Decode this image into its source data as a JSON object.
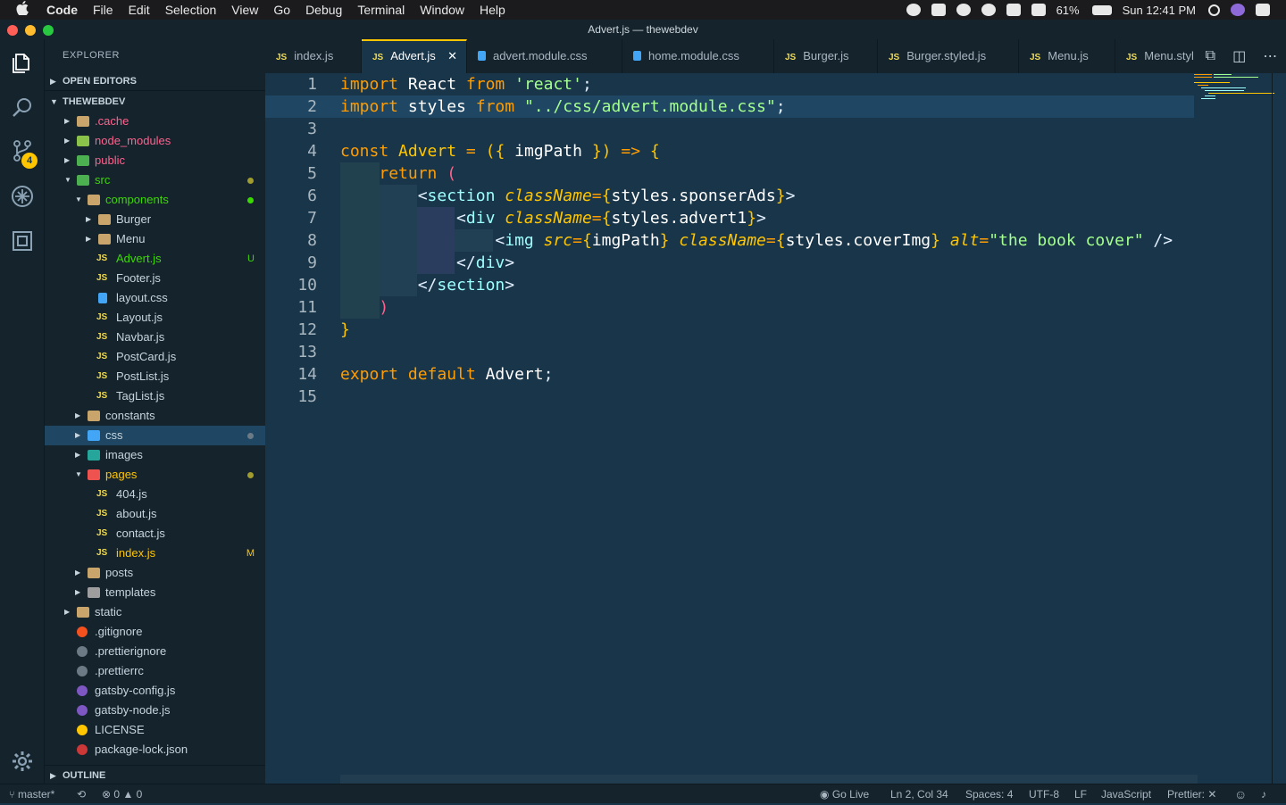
{
  "menubar": {
    "app": "Code",
    "items": [
      "File",
      "Edit",
      "Selection",
      "View",
      "Go",
      "Debug",
      "Terminal",
      "Window",
      "Help"
    ],
    "battery": "61%",
    "clock": "Sun 12:41 PM"
  },
  "window": {
    "title": "Advert.js — thewebdev"
  },
  "sidebar": {
    "header": "EXPLORER",
    "open_editors": "OPEN EDITORS",
    "project": "THEWEBDEV",
    "outline": "OUTLINE",
    "tree": [
      {
        "label": ".cache",
        "depth": 0,
        "kind": "folder",
        "arrow": "right",
        "color": "#ff628c"
      },
      {
        "label": "node_modules",
        "depth": 0,
        "kind": "folder-node",
        "arrow": "right",
        "color": "#ff628c"
      },
      {
        "label": "public",
        "depth": 0,
        "kind": "folder-public",
        "arrow": "right",
        "color": "#ff628c"
      },
      {
        "label": "src",
        "depth": 0,
        "kind": "folder-src",
        "arrow": "down",
        "color": "#3ad900",
        "dot": "#a09c2d"
      },
      {
        "label": "components",
        "depth": 1,
        "kind": "folder-comp",
        "arrow": "down",
        "color": "#3ad900",
        "dot": "#3ad900"
      },
      {
        "label": "Burger",
        "depth": 2,
        "kind": "folder",
        "arrow": "right",
        "color": "#c6d4de"
      },
      {
        "label": "Menu",
        "depth": 2,
        "kind": "folder",
        "arrow": "right",
        "color": "#c6d4de"
      },
      {
        "label": "Advert.js",
        "depth": 2,
        "kind": "js",
        "color": "#3ad900",
        "status": "U",
        "status_color": "#3ad900"
      },
      {
        "label": "Footer.js",
        "depth": 2,
        "kind": "js",
        "color": "#c6d4de"
      },
      {
        "label": "layout.css",
        "depth": 2,
        "kind": "css",
        "color": "#c6d4de"
      },
      {
        "label": "Layout.js",
        "depth": 2,
        "kind": "js",
        "color": "#c6d4de"
      },
      {
        "label": "Navbar.js",
        "depth": 2,
        "kind": "js",
        "color": "#c6d4de"
      },
      {
        "label": "PostCard.js",
        "depth": 2,
        "kind": "js",
        "color": "#c6d4de"
      },
      {
        "label": "PostList.js",
        "depth": 2,
        "kind": "js",
        "color": "#c6d4de"
      },
      {
        "label": "TagList.js",
        "depth": 2,
        "kind": "js",
        "color": "#c6d4de"
      },
      {
        "label": "constants",
        "depth": 1,
        "kind": "folder",
        "arrow": "right",
        "color": "#c6d4de"
      },
      {
        "label": "css",
        "depth": 1,
        "kind": "folder-css",
        "arrow": "right",
        "color": "#c6d4de",
        "selected": true,
        "dot": "#6c7a86"
      },
      {
        "label": "images",
        "depth": 1,
        "kind": "folder-img",
        "arrow": "right",
        "color": "#c6d4de"
      },
      {
        "label": "pages",
        "depth": 1,
        "kind": "folder-pages",
        "arrow": "down",
        "color": "#ffc600",
        "dot": "#a09c2d"
      },
      {
        "label": "404.js",
        "depth": 2,
        "kind": "js",
        "color": "#c6d4de"
      },
      {
        "label": "about.js",
        "depth": 2,
        "kind": "js",
        "color": "#c6d4de"
      },
      {
        "label": "contact.js",
        "depth": 2,
        "kind": "js",
        "color": "#c6d4de"
      },
      {
        "label": "index.js",
        "depth": 2,
        "kind": "js",
        "color": "#ffc600",
        "status": "M",
        "status_color": "#ffc600"
      },
      {
        "label": "posts",
        "depth": 1,
        "kind": "folder",
        "arrow": "right",
        "color": "#c6d4de"
      },
      {
        "label": "templates",
        "depth": 1,
        "kind": "folder-tpl",
        "arrow": "right",
        "color": "#c6d4de"
      },
      {
        "label": "static",
        "depth": 0,
        "kind": "folder",
        "arrow": "right",
        "color": "#c6d4de"
      },
      {
        "label": ".gitignore",
        "depth": 0,
        "kind": "git",
        "color": "#c6d4de"
      },
      {
        "label": ".prettierignore",
        "depth": 0,
        "kind": "prettier",
        "color": "#c6d4de"
      },
      {
        "label": ".prettierrc",
        "depth": 0,
        "kind": "prettier",
        "color": "#c6d4de"
      },
      {
        "label": "gatsby-config.js",
        "depth": 0,
        "kind": "gatsby",
        "color": "#c6d4de"
      },
      {
        "label": "gatsby-node.js",
        "depth": 0,
        "kind": "gatsby",
        "color": "#c6d4de"
      },
      {
        "label": "LICENSE",
        "depth": 0,
        "kind": "license",
        "color": "#c6d4de"
      },
      {
        "label": "package-lock.json",
        "depth": 0,
        "kind": "npm",
        "color": "#c6d4de"
      }
    ]
  },
  "activity": {
    "scm_badge": "4"
  },
  "tabs": [
    {
      "label": "index.js",
      "kind": "js",
      "width": 108
    },
    {
      "label": "Advert.js",
      "kind": "js",
      "active": true,
      "width": 118,
      "close": "✕"
    },
    {
      "label": "advert.module.css",
      "kind": "css",
      "width": 174
    },
    {
      "label": "home.module.css",
      "kind": "css",
      "width": 170
    },
    {
      "label": "Burger.js",
      "kind": "js",
      "width": 116
    },
    {
      "label": "Burger.styled.js",
      "kind": "js",
      "width": 158
    },
    {
      "label": "Menu.js",
      "kind": "js",
      "width": 108
    },
    {
      "label": "Menu.styl",
      "kind": "js",
      "width": 92
    }
  ],
  "editor": {
    "current_line": 2,
    "lines": [
      {
        "n": "1",
        "html": "<span class='kw'>import</span> <span class='var'>React</span> <span class='kw'>from</span> <span class='str'>'react'</span><span class='punc'>;</span>"
      },
      {
        "n": "2",
        "html": "<span class='kw'>import</span> <span class='var'>styles</span> <span class='kw'>from</span> <span class='str'>\"../css/advert.module.css\"</span><span class='punc'>;</span>"
      },
      {
        "n": "3",
        "html": ""
      },
      {
        "n": "4",
        "html": "<span class='kw'>const</span> <span class='fn'>Advert</span> <span class='kw'>=</span> <span class='brace'>(</span><span class='brace'>{</span> <span class='var'>imgPath</span> <span class='brace'>}</span><span class='brace'>)</span> <span class='kw'>=&gt;</span> <span class='brace'>{</span>"
      },
      {
        "n": "5",
        "html": "    <span class='kw'>return</span> <span class='paren'>(</span>"
      },
      {
        "n": "6",
        "html": "        <span class='punc'>&lt;</span><span class='tag'>section</span> <span class='attr'>className</span><span class='kw'>=</span><span class='brace'>{</span><span class='var'>styles.sponserAds</span><span class='brace'>}</span><span class='punc'>&gt;</span>"
      },
      {
        "n": "7",
        "html": "            <span class='punc'>&lt;</span><span class='tag'>div</span> <span class='attr'>className</span><span class='kw'>=</span><span class='brace'>{</span><span class='var'>styles.advert1</span><span class='brace'>}</span><span class='punc'>&gt;</span>"
      },
      {
        "n": "8",
        "html": "                <span class='punc'>&lt;</span><span class='tag'>img</span> <span class='attr'>src</span><span class='kw'>=</span><span class='brace'>{</span><span class='var'>imgPath</span><span class='brace'>}</span> <span class='attr'>className</span><span class='kw'>=</span><span class='brace'>{</span><span class='var'>styles.coverImg</span><span class='brace'>}</span> <span class='attr'>alt</span><span class='kw'>=</span><span class='str'>\"the book cover\"</span> <span class='punc'>/&gt;</span>"
      },
      {
        "n": "9",
        "html": "            <span class='punc'>&lt;/</span><span class='tag'>div</span><span class='punc'>&gt;</span>"
      },
      {
        "n": "10",
        "html": "        <span class='punc'>&lt;/</span><span class='tag'>section</span><span class='punc'>&gt;</span>"
      },
      {
        "n": "11",
        "html": "    <span class='paren'>)</span>"
      },
      {
        "n": "12",
        "html": "<span class='brace'>}</span>"
      },
      {
        "n": "13",
        "html": ""
      },
      {
        "n": "14",
        "html": "<span class='kw'>export</span> <span class='kw'>default</span> <span class='var'>Advert</span><span class='punc'>;</span>"
      },
      {
        "n": "15",
        "html": ""
      }
    ]
  },
  "statusbar": {
    "branch": "master*",
    "errors": "0",
    "warnings": "0",
    "go_live": "Go Live",
    "position": "Ln 2, Col 34",
    "spaces": "Spaces: 4",
    "encoding": "UTF-8",
    "eol": "LF",
    "language": "JavaScript",
    "prettier": "Prettier: ✕"
  },
  "colors": {
    "accent": "#ffc600",
    "bg": "#193549",
    "sidebar": "#15232d"
  }
}
